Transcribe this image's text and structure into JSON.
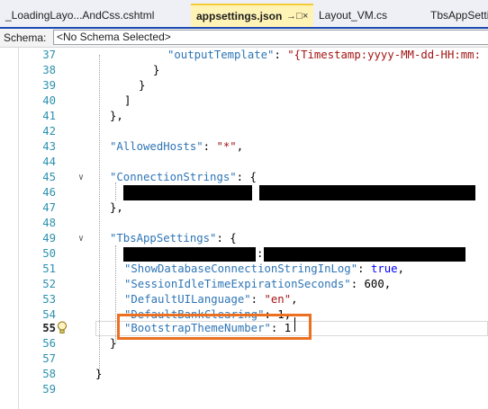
{
  "tabs": [
    {
      "label": "_LoadingLayo...AndCss.cshtml",
      "active": false
    },
    {
      "label": "appsettings.json",
      "active": true,
      "pin": "→□",
      "close": "×"
    },
    {
      "label": "Layout_VM.cs",
      "active": false
    },
    {
      "label": "TbsAppSetti",
      "active": false
    }
  ],
  "schema": {
    "label": "Schema:",
    "value": "<No Schema Selected>"
  },
  "lines": [
    {
      "n": "37"
    },
    {
      "n": "38"
    },
    {
      "n": "39"
    },
    {
      "n": "40"
    },
    {
      "n": "41"
    },
    {
      "n": "42"
    },
    {
      "n": "43"
    },
    {
      "n": "44"
    },
    {
      "n": "45"
    },
    {
      "n": "46"
    },
    {
      "n": "47"
    },
    {
      "n": "48"
    },
    {
      "n": "49"
    },
    {
      "n": "50"
    },
    {
      "n": "51"
    },
    {
      "n": "52"
    },
    {
      "n": "53"
    },
    {
      "n": "54"
    },
    {
      "n": "55"
    },
    {
      "n": "56"
    },
    {
      "n": "57"
    },
    {
      "n": "58"
    },
    {
      "n": "59"
    }
  ],
  "code": {
    "l37_key": "\"outputTemplate\"",
    "l37_val": "\"{Timestamp:yyyy-MM-dd-HH:mm:",
    "l43_key": "\"AllowedHosts\"",
    "l43_val": "\"*\"",
    "l45_key": "\"ConnectionStrings\"",
    "l49_key": "\"TbsAppSettings\"",
    "l51_key": "\"ShowDatabaseConnectionStringInLog\"",
    "l51_val": "true",
    "l52_key": "\"SessionIdleTimeExpirationSeconds\"",
    "l52_val": "600",
    "l53_key": "\"DefaultUILanguage\"",
    "l53_val": "\"en\"",
    "l54_key": "\"DefaultBankClearing\"",
    "l54_val": "1",
    "l55_key": "\"BootstrapThemeNumber\"",
    "l55_val": "1"
  },
  "colors": {
    "accent": "#1c48b4",
    "highlight_box": "#ec7020",
    "json_key": "#2e75b6",
    "json_string": "#a31515",
    "json_keyword": "#0000ff",
    "line_number": "#2b91af"
  },
  "icons": {
    "lightbulb": "lightbulb-icon",
    "fold": "collapse-chevron-icon"
  }
}
